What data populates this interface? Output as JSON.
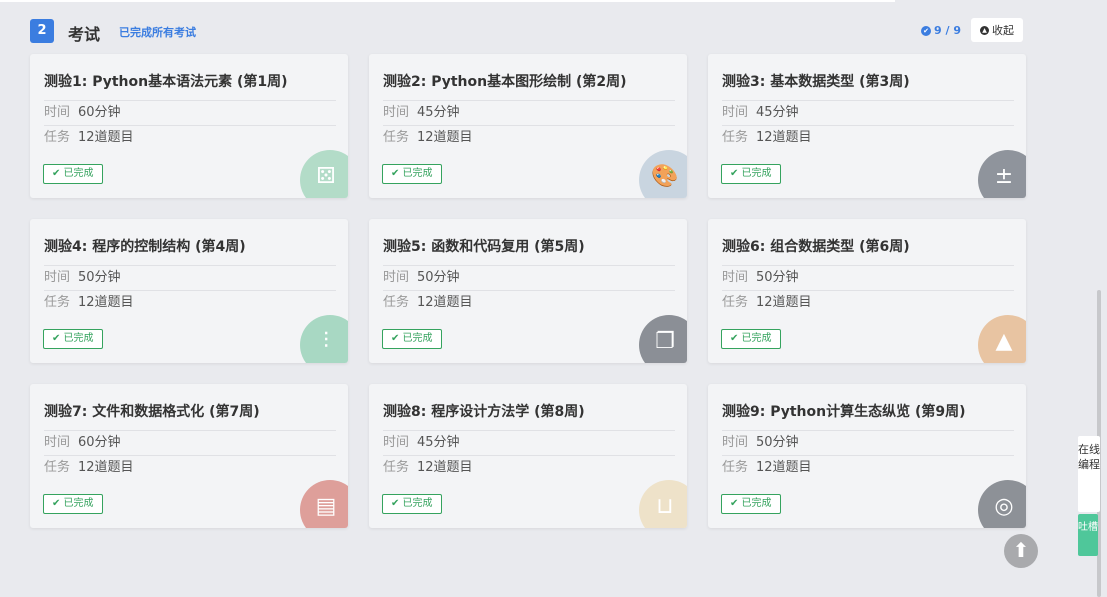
{
  "section": {
    "number": "2",
    "title": "考试",
    "subtitle": "已完成所有考试",
    "progress": "9 / 9",
    "collapse_label": "收起"
  },
  "labels": {
    "time": "时间",
    "task": "任务",
    "done": "✔ 已完成"
  },
  "quizzes": [
    {
      "title": "测验1: Python基本语法元素 (第1周)",
      "time": "60分钟",
      "task": "12道题目",
      "icon": "dice-icon",
      "icon_color": "#b3dcc8",
      "glyph": "⚄"
    },
    {
      "title": "测验2: Python基本图形绘制 (第2周)",
      "time": "45分钟",
      "task": "12道题目",
      "icon": "palette-icon",
      "icon_color": "#c9d5e0",
      "glyph": "🎨"
    },
    {
      "title": "测验3: 基本数据类型 (第3周)",
      "time": "45分钟",
      "task": "12道题目",
      "icon": "calculator-icon",
      "icon_color": "#8f949c",
      "glyph": "±"
    },
    {
      "title": "测验4: 程序的控制结构 (第4周)",
      "time": "50分钟",
      "task": "12道题目",
      "icon": "sliders-icon",
      "icon_color": "#a8d8c3",
      "glyph": "⫶"
    },
    {
      "title": "测验5: 函数和代码复用 (第5周)",
      "time": "50分钟",
      "task": "12道题目",
      "icon": "windows-icon",
      "icon_color": "#8b8f96",
      "glyph": "❐"
    },
    {
      "title": "测验6: 组合数据类型 (第6周)",
      "time": "50分钟",
      "task": "12道题目",
      "icon": "cone-icon",
      "icon_color": "#e8c4a2",
      "glyph": "▲"
    },
    {
      "title": "测验7: 文件和数据格式化 (第7周)",
      "time": "60分钟",
      "task": "12道题目",
      "icon": "contacts-book-icon",
      "icon_color": "#de9f9a",
      "glyph": "▤"
    },
    {
      "title": "测验8: 程序设计方法学 (第8周)",
      "time": "45分钟",
      "task": "12道题目",
      "icon": "basket-icon",
      "icon_color": "#eee2c9",
      "glyph": "⊔"
    },
    {
      "title": "测验9: Python计算生态纵览 (第9周)",
      "time": "50分钟",
      "task": "12道题目",
      "icon": "target-icon",
      "icon_color": "#8d9197",
      "glyph": "◎"
    }
  ],
  "side": {
    "online_coding": "在线编程",
    "feedback": "吐槽",
    "scroll_top_glyph": "⬆"
  }
}
